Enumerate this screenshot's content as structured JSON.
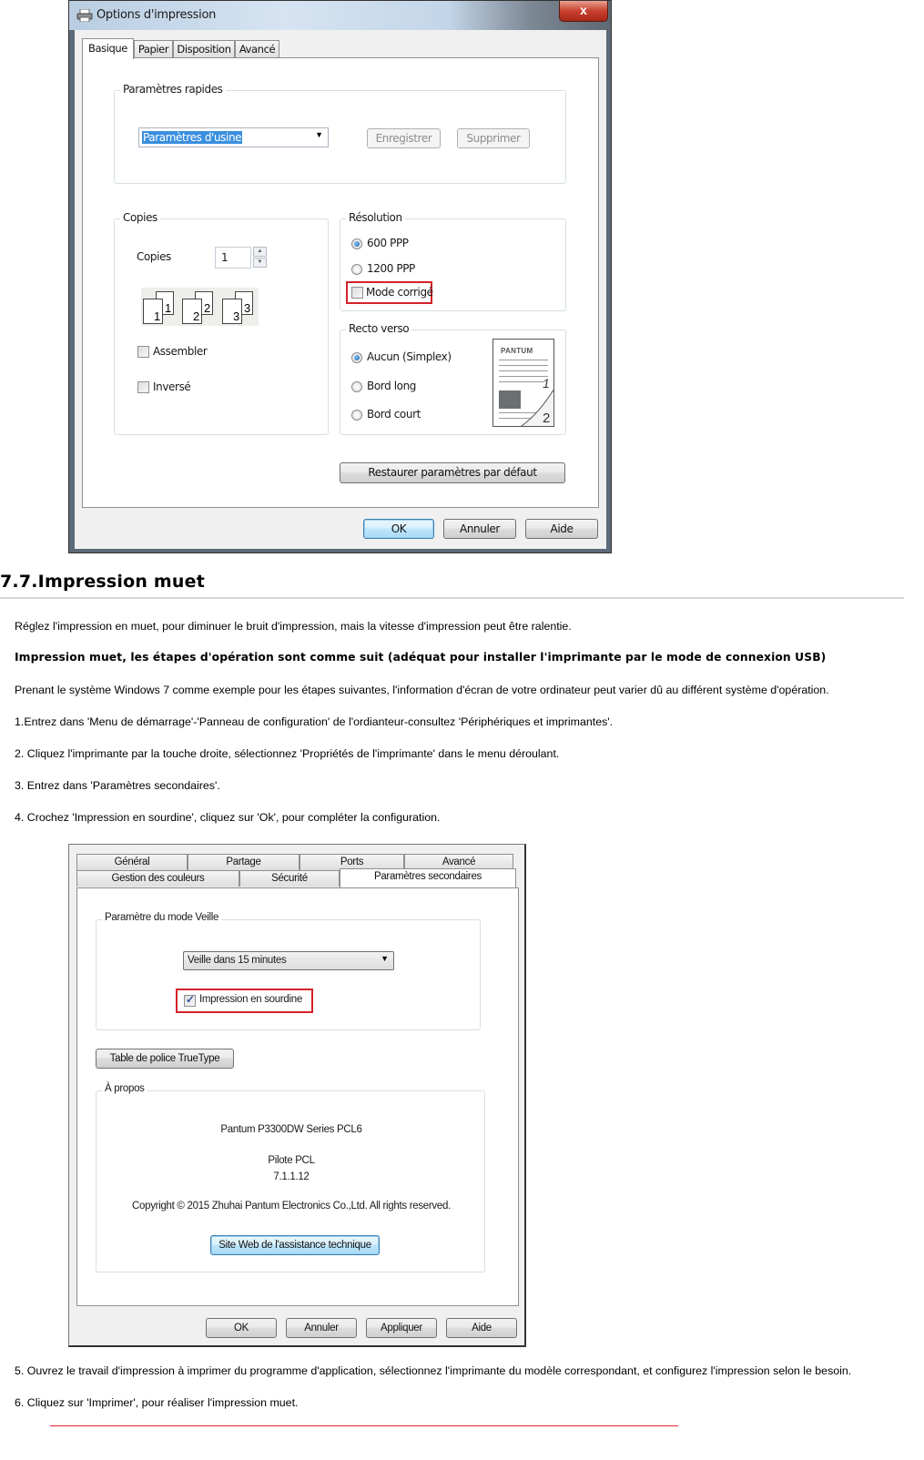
{
  "dialog1": {
    "title": "Options d'impression",
    "close_label": "x",
    "tabs": [
      "Basique",
      "Papier",
      "Disposition",
      "Avancé"
    ],
    "active_tab": "Basique",
    "quick_settings": {
      "group_label": "Paramètres rapides",
      "selected_value": "Paramètres d'usine",
      "save_label": "Enregistrer",
      "delete_label": "Supprimer"
    },
    "copies": {
      "group_label": "Copies",
      "field_label": "Copies",
      "value": "1",
      "collate_pages": [
        "1",
        "2",
        "3"
      ],
      "assemble_label": "Assembler",
      "assemble_checked": false,
      "reverse_label": "Inversé",
      "reverse_checked": false
    },
    "resolution": {
      "group_label": "Résolution",
      "options": [
        {
          "label": "600 PPP",
          "selected": true
        },
        {
          "label": "1200 PPP",
          "selected": false
        }
      ],
      "corrected_mode_label": "Mode corrigé",
      "corrected_mode_checked": false
    },
    "duplex": {
      "group_label": "Recto verso",
      "options": [
        {
          "label": "Aucun (Simplex)",
          "selected": true
        },
        {
          "label": "Bord long",
          "selected": false
        },
        {
          "label": "Bord court",
          "selected": false
        }
      ],
      "preview_brand": "PANTUM",
      "preview_page1": "1",
      "preview_page2": "2"
    },
    "restore_label": "Restaurer paramètres par défaut",
    "ok_label": "OK",
    "cancel_label": "Annuler",
    "help_label": "Aide",
    "highlight_color": "#d3222a"
  },
  "document": {
    "section_title": "7.7.Impression muet",
    "intro": "Réglez l'impression en muet, pour diminuer le bruit d'impression, mais la vitesse d'impression peut être ralentie.",
    "steps_heading": "Impression muet, les étapes d'opération sont comme suit (adéquat pour installer l'imprimante par le mode de connexion USB)",
    "note": "Prenant le système Windows 7 comme exemple pour les étapes suivantes, l'information d'écran de votre ordinateur peut varier dû au différent système d'opération.",
    "steps": [
      "1.Entrez dans 'Menu de démarrage'-'Panneau de configuration' de l'ordianteur-consultez 'Périphériques et imprimantes'.",
      "2. Cliquez l'imprimante par la touche droite, sélectionnez 'Propriétés de l'imprimante' dans le menu déroulant.",
      "3. Entrez dans 'Paramètres secondaires'.",
      "4. Crochez 'Impression en sourdine', cliquez sur 'Ok', pour compléter la configuration."
    ],
    "steps_after": [
      "5. Ouvrez le travail d'impression à imprimer du programme d'application, sélectionnez l'imprimante du modèle correspondant, et configurez l'impression selon le besoin.",
      "6. Cliquez sur 'Imprimer', pour réaliser l'impression muet."
    ],
    "divider_color": "#e0262c"
  },
  "dialog2": {
    "tabs_row1": [
      "Général",
      "Partage",
      "Ports",
      "Avancé"
    ],
    "tabs_row2": [
      "Gestion des couleurs",
      "Sécurité",
      "Paramètres secondaires"
    ],
    "active_tab": "Paramètres secondaires",
    "sleep": {
      "group_label": "Paramètre du mode Veille",
      "selected_value": "Veille dans 15 minutes",
      "silent_label": "Impression en sourdine",
      "silent_checked": true
    },
    "truetype_label": "Table de police TrueType",
    "about": {
      "group_label": "À propos",
      "product": "Pantum P3300DW Series PCL6",
      "driver": "Pilote PCL",
      "version": "7.1.1.12",
      "copyright": "Copyright © 2015 Zhuhai Pantum Electronics Co.,Ltd. All rights reserved.",
      "support_label": "Site Web de l'assistance technique"
    },
    "ok_label": "OK",
    "cancel_label": "Annuler",
    "apply_label": "Appliquer",
    "help_label": "Aide"
  }
}
